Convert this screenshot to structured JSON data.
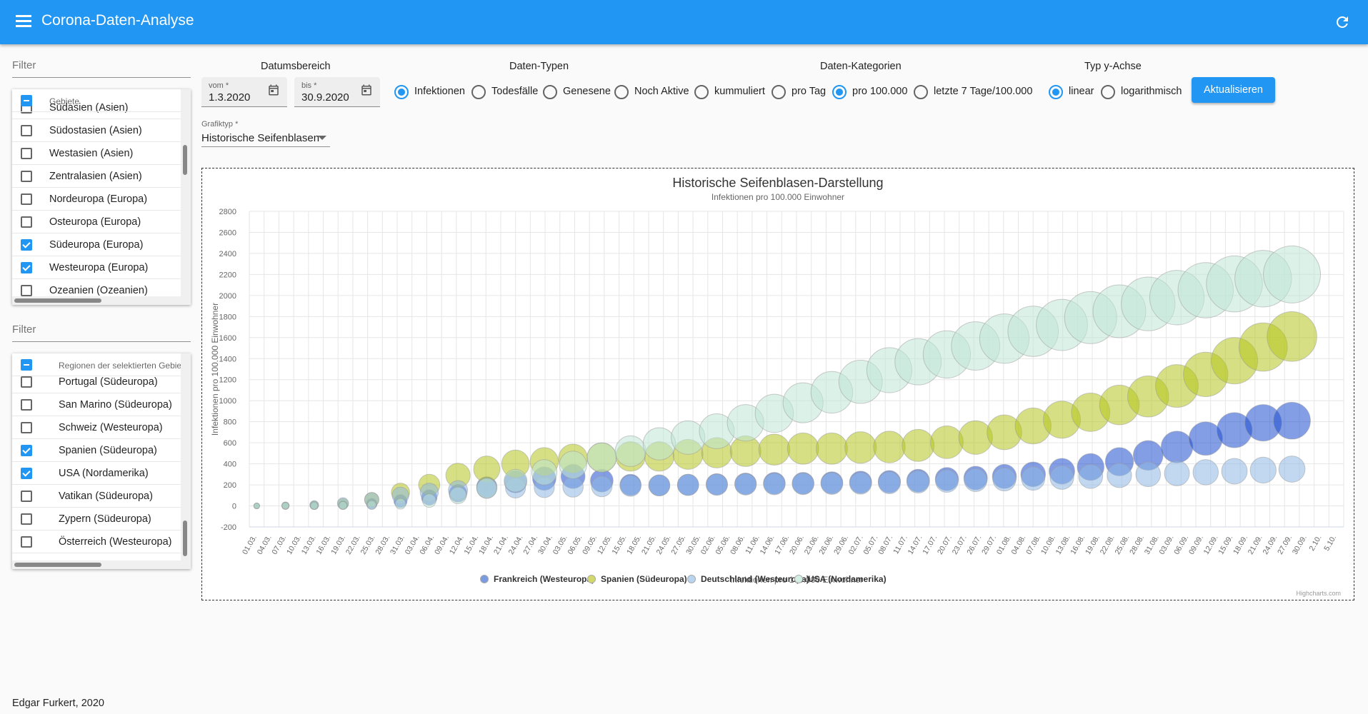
{
  "app": {
    "title": "Corona-Daten-Analyse",
    "menu_icon": "menu-icon",
    "refresh_icon": "refresh-icon",
    "accent": "#2196f3"
  },
  "gebiete": {
    "filter_placeholder": "Filter",
    "header": "Gebiete",
    "items": [
      {
        "label": "Südasien (Asien)",
        "checked": false
      },
      {
        "label": "Südostasien (Asien)",
        "checked": false
      },
      {
        "label": "Westasien (Asien)",
        "checked": false
      },
      {
        "label": "Zentralasien (Asien)",
        "checked": false
      },
      {
        "label": "Nordeuropa (Europa)",
        "checked": false
      },
      {
        "label": "Osteuropa (Europa)",
        "checked": false
      },
      {
        "label": "Südeuropa (Europa)",
        "checked": true
      },
      {
        "label": "Westeuropa (Europa)",
        "checked": true
      },
      {
        "label": "Ozeanien (Ozeanien)",
        "checked": false
      }
    ]
  },
  "regionen": {
    "filter_placeholder": "Filter",
    "header": "Regionen der selektierten Gebiete",
    "items": [
      {
        "label": "Portugal (Südeuropa)",
        "checked": false
      },
      {
        "label": "San Marino (Südeuropa)",
        "checked": false
      },
      {
        "label": "Schweiz (Westeuropa)",
        "checked": false
      },
      {
        "label": "Spanien (Südeuropa)",
        "checked": true
      },
      {
        "label": "USA (Nordamerika)",
        "checked": true
      },
      {
        "label": "Vatikan (Südeuropa)",
        "checked": false
      },
      {
        "label": "Zypern (Südeuropa)",
        "checked": false
      },
      {
        "label": "Österreich (Westeuropa)",
        "checked": false
      }
    ]
  },
  "controls": {
    "datumsbereich_label": "Datumsbereich",
    "vom_label": "vom *",
    "vom_value": "1.3.2020",
    "bis_label": "bis *",
    "bis_value": "30.9.2020",
    "daten_typen_label": "Daten-Typen",
    "daten_typen": [
      {
        "label": "Infektionen",
        "selected": true
      },
      {
        "label": "Todesfälle",
        "selected": false
      },
      {
        "label": "Genesene",
        "selected": false
      },
      {
        "label": "Noch Aktive",
        "selected": false
      },
      {
        "label": "kummuliert",
        "selected": false
      }
    ],
    "daten_kategorien_label": "Daten-Kategorien",
    "daten_kategorien": [
      {
        "label": "pro Tag",
        "selected": false
      },
      {
        "label": "pro 100.000",
        "selected": true
      },
      {
        "label": "letzte 7 Tage/100.000",
        "selected": false
      }
    ],
    "y_achse_label": "Typ y-Achse",
    "y_achse": [
      {
        "label": "linear",
        "selected": true
      },
      {
        "label": "logarithmisch",
        "selected": false
      }
    ],
    "update_button": "Aktualisieren",
    "grafiktyp_label": "Grafiktyp *",
    "grafiktyp_value": "Historische Seifenblasen"
  },
  "chart_data": {
    "type": "scatter",
    "title": "Historische Seifenblasen-Darstellung",
    "subtitle": "Infektionen pro 100.000 Einwohner",
    "xlabel": "Infektionen pro 100.000 Einwohner",
    "ylabel": "Infektionen pro 100.000 Einwohner",
    "ylim": [
      -200,
      2800
    ],
    "yticks": [
      -200,
      0,
      200,
      400,
      600,
      800,
      1000,
      1200,
      1400,
      1600,
      1800,
      2000,
      2200,
      2400,
      2600,
      2800
    ],
    "categories": [
      "01.03.",
      "04.03.",
      "07.03.",
      "10.03.",
      "13.03.",
      "16.03.",
      "19.03.",
      "22.03.",
      "25.03.",
      "28.03.",
      "31.03.",
      "03.04.",
      "06.04.",
      "09.04.",
      "12.04.",
      "15.04.",
      "18.04.",
      "21.04.",
      "24.04.",
      "27.04.",
      "30.04.",
      "03.05.",
      "06.05.",
      "09.05.",
      "12.05.",
      "15.05.",
      "18.05.",
      "21.05.",
      "24.05.",
      "27.05.",
      "30.05.",
      "02.06.",
      "05.06.",
      "08.06.",
      "11.06.",
      "14.06.",
      "17.06.",
      "20.06.",
      "23.06.",
      "26.06.",
      "29.06.",
      "02.07.",
      "05.07.",
      "08.07.",
      "11.07.",
      "14.07.",
      "17.07.",
      "20.07.",
      "23.07.",
      "26.07.",
      "29.07.",
      "01.08.",
      "04.08.",
      "07.08.",
      "10.08.",
      "13.08.",
      "16.08.",
      "19.08.",
      "22.08.",
      "25.08.",
      "28.08.",
      "31.08.",
      "03.09.",
      "06.09.",
      "09.09.",
      "12.09.",
      "15.09.",
      "18.09.",
      "21.09.",
      "24.09.",
      "27.09.",
      "30.09.",
      "2.10.",
      "5.10."
    ],
    "series": [
      {
        "name": "Frankreich (Westeuropa)",
        "color": "#1f4fcf",
        "legend_color": "#7a9be0",
        "values": [
          0,
          1,
          3,
          8,
          20,
          45,
          80,
          120,
          180,
          230,
          260,
          280,
          240,
          200,
          195,
          200,
          205,
          210,
          215,
          215,
          220,
          225,
          230,
          240,
          255,
          265,
          280,
          300,
          330,
          370,
          420,
          480,
          560,
          640,
          720,
          790,
          810
        ]
      },
      {
        "name": "Spanien (Südeuropa)",
        "color": "#b4c41e",
        "legend_color": "#d2d96a",
        "values": [
          0,
          2,
          6,
          20,
          60,
          130,
          200,
          290,
          350,
          400,
          420,
          450,
          460,
          470,
          470,
          490,
          505,
          520,
          535,
          545,
          545,
          555,
          560,
          575,
          605,
          650,
          700,
          760,
          820,
          890,
          960,
          1040,
          1140,
          1250,
          1380,
          1510,
          1610
        ]
      },
      {
        "name": "Deutschland (Westeuropa)",
        "color": "#8fb8e4",
        "legend_color": "#b8d4ee",
        "values": [
          0,
          2,
          8,
          25,
          60,
          100,
          130,
          150,
          165,
          170,
          175,
          180,
          185,
          190,
          195,
          200,
          202,
          205,
          208,
          210,
          212,
          215,
          220,
          228,
          236,
          245,
          252,
          260,
          270,
          280,
          290,
          300,
          310,
          320,
          330,
          340,
          350
        ]
      },
      {
        "name": "USA (Nordamerika)",
        "color": "#bfe6d6",
        "legend_color": "#d4efe3",
        "values": [
          0,
          1,
          2,
          4,
          8,
          20,
          50,
          100,
          170,
          240,
          320,
          390,
          460,
          520,
          590,
          650,
          710,
          790,
          880,
          980,
          1080,
          1180,
          1290,
          1370,
          1440,
          1520,
          1590,
          1660,
          1720,
          1790,
          1850,
          1920,
          1980,
          2050,
          2110,
          2160,
          2200
        ]
      }
    ],
    "legend_position": "bottom",
    "grid": true,
    "credits": "Highcharts.com"
  },
  "footer": "Edgar Furkert, 2020"
}
